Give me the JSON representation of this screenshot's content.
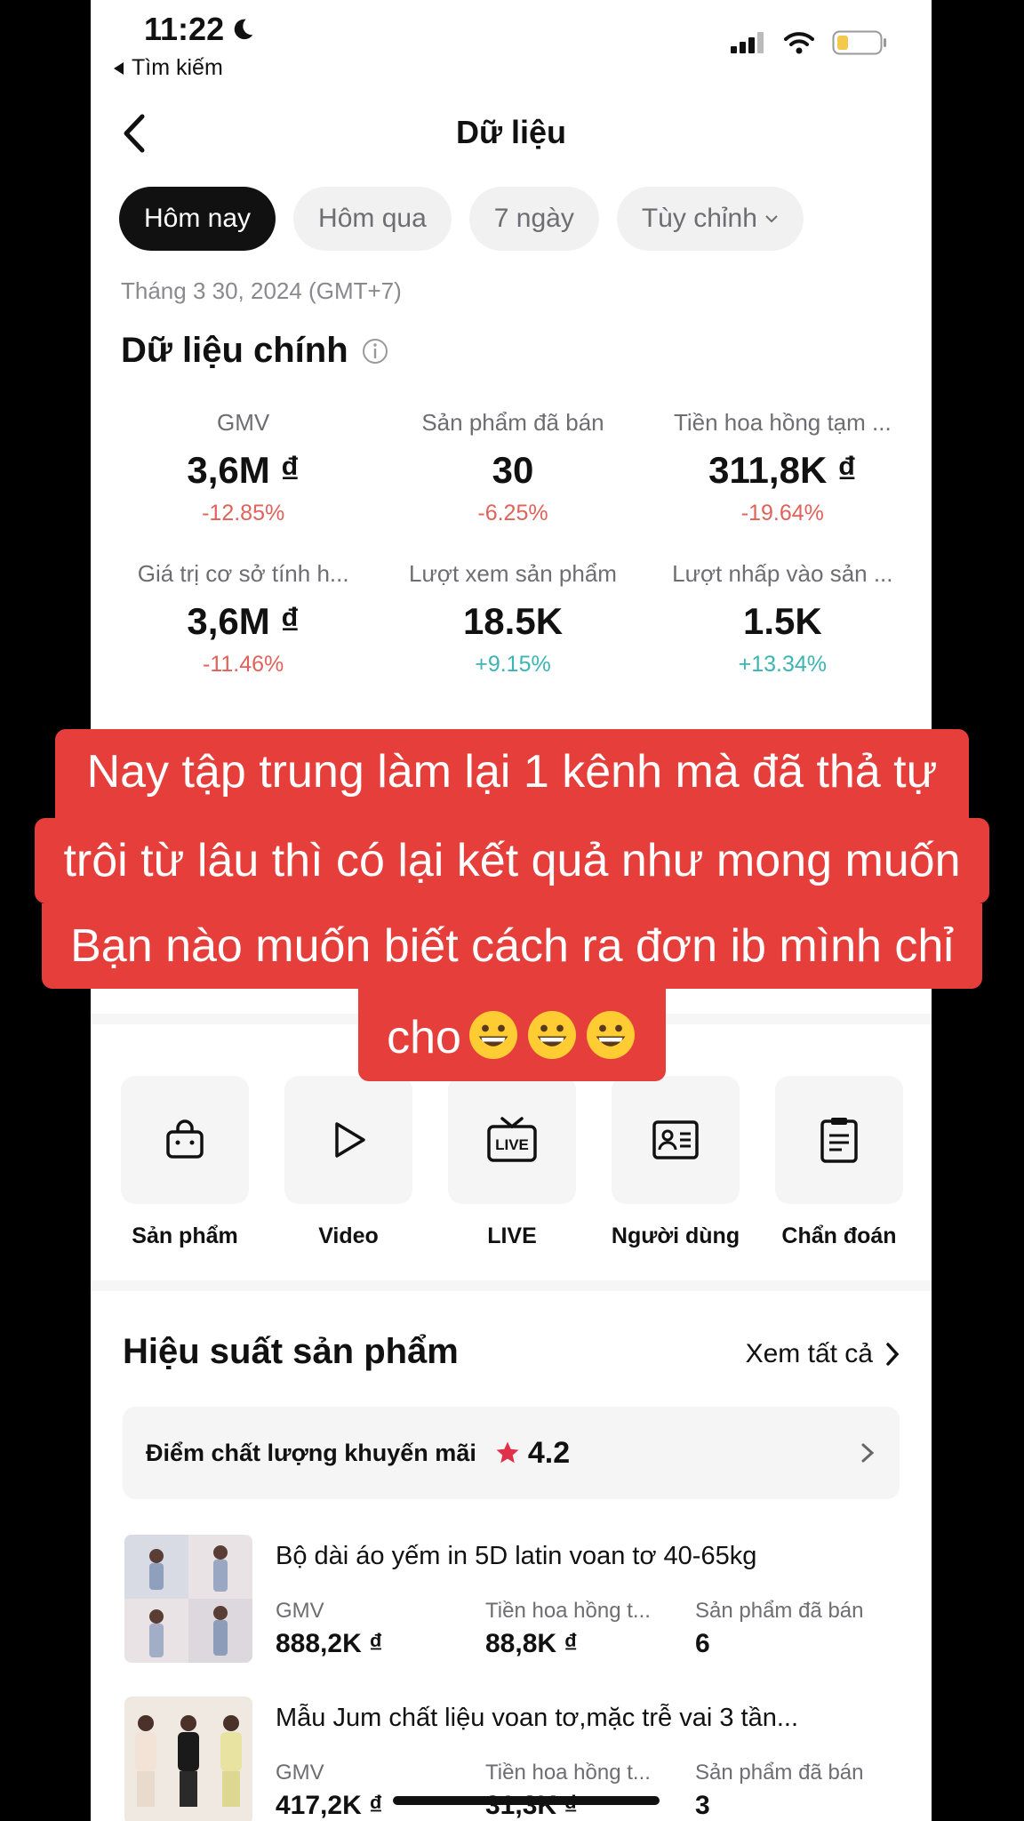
{
  "status_bar": {
    "time": "11:22",
    "back_label": "Tìm kiếm"
  },
  "header": {
    "title": "Dữ liệu"
  },
  "tabs": [
    {
      "label": "Hôm nay"
    },
    {
      "label": "Hôm qua"
    },
    {
      "label": "7 ngày"
    },
    {
      "label": "Tùy chỉnh"
    }
  ],
  "date": "Tháng 3 30, 2024 (GMT+7)",
  "main_data": {
    "title": "Dữ liệu chính",
    "metrics": [
      {
        "label": "GMV",
        "value": "3,6M ₫",
        "change": "-12.85%"
      },
      {
        "label": "Sản phẩm đã bán",
        "value": "30",
        "change": "-6.25%"
      },
      {
        "label": "Tiền hoa hồng tạm ...",
        "value": "311,8K ₫",
        "change": "-19.64%"
      },
      {
        "label": "Giá trị cơ sở tính h...",
        "value": "3,6M ₫",
        "change": "-11.46%"
      },
      {
        "label": "Lượt xem sản phẩm",
        "value": "18.5K",
        "change": "+9.15%"
      },
      {
        "label": "Lượt nhấp vào sản ...",
        "value": "1.5K",
        "change": "+13.34%"
      }
    ]
  },
  "caption": {
    "line1": "Nay tập trung làm lại 1 kênh mà đã thả tự",
    "line2": "trôi từ lâu thì có lại kết quả như mong muốn",
    "line3": "Bạn nào muốn biết cách ra đơn ib mình chỉ",
    "line4": "cho"
  },
  "shortcuts": [
    {
      "label": "Sản phẩm",
      "icon": "shopping-bag-icon"
    },
    {
      "label": "Video",
      "icon": "play-icon"
    },
    {
      "label": "LIVE",
      "icon": "live-tv-icon"
    },
    {
      "label": "Người dùng",
      "icon": "user-card-icon"
    },
    {
      "label": "Chẩn đoán",
      "icon": "clipboard-icon"
    }
  ],
  "product_performance": {
    "title": "Hiệu suất sản phẩm",
    "view_all": "Xem tất cả",
    "promo_label": "Điểm chất lượng khuyến mãi",
    "promo_score": "4.2",
    "products": [
      {
        "name": "Bộ dài áo yếm in 5D latin voan tơ 40-65kg",
        "stats": [
          {
            "label": "GMV",
            "value": "888,2K ₫"
          },
          {
            "label": "Tiền hoa hồng t...",
            "value": "88,8K ₫"
          },
          {
            "label": "Sản phẩm đã bán",
            "value": "6"
          }
        ]
      },
      {
        "name": "Mẫu Jum chất liệu voan tơ,mặc trễ vai 3 tần...",
        "stats": [
          {
            "label": "GMV",
            "value": "417,2K ₫"
          },
          {
            "label": "Tiền hoa hồng t...",
            "value": "31,3K ₫"
          },
          {
            "label": "Sản phẩm đã bán",
            "value": "3"
          }
        ]
      }
    ]
  },
  "colors": {
    "negative": "#e0625a",
    "positive": "#3cb4b4",
    "caption_bg": "#e53e3b",
    "star": "#e0304a"
  }
}
